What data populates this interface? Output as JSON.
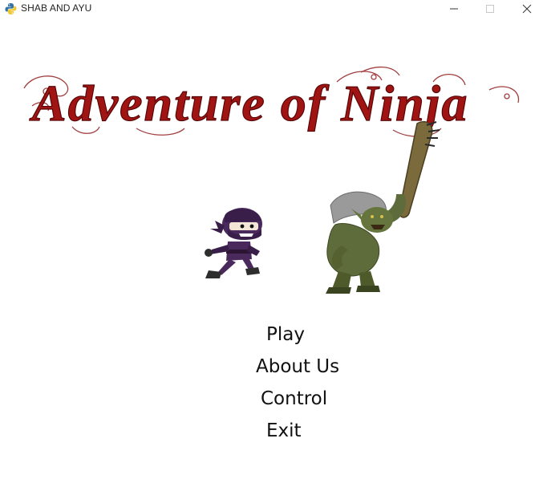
{
  "window": {
    "title": "SHAB AND AYU",
    "icon": "python-icon",
    "controls": [
      "minimize-icon",
      "maximize-icon",
      "close-icon"
    ]
  },
  "game": {
    "title": "Adventure of Ninja",
    "title_color": "#a01414",
    "characters": [
      "ninja-sprite",
      "troll-sprite"
    ]
  },
  "menu": {
    "items": [
      {
        "label": "Play"
      },
      {
        "label": "About Us"
      },
      {
        "label": "Control"
      },
      {
        "label": "Exit"
      }
    ]
  },
  "colors": {
    "background": "#ffffff",
    "menu_text": "#111111",
    "ninja": "#4a2a5c",
    "troll": "#5e6b3a"
  }
}
